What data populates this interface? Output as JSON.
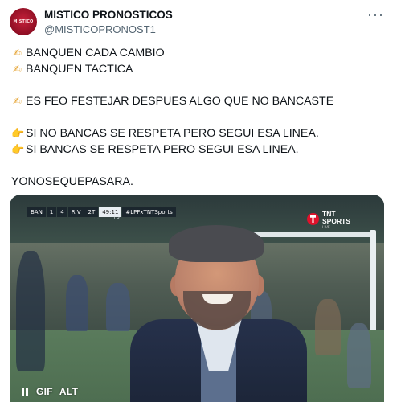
{
  "post": {
    "author_name": "MISTICO PRONOSTICOS",
    "author_handle": "@MISTICOPRONOST1",
    "avatar_text": "MISTICO",
    "more_label": "···",
    "lines": [
      {
        "emoji": "✍",
        "emoji_kind": "writing-hand-icon",
        "text": "BANQUEN CADA CAMBIO"
      },
      {
        "emoji": "✍",
        "emoji_kind": "writing-hand-icon",
        "text": "BANQUEN TACTICA"
      },
      {
        "gap": true
      },
      {
        "emoji": "✍",
        "emoji_kind": "writing-hand-icon",
        "text": "ES FEO FESTEJAR DESPUES ALGO QUE NO BANCASTE"
      },
      {
        "gap": true
      },
      {
        "emoji": "👉",
        "emoji_kind": "pointing-hand-icon",
        "text": "SI NO BANCAS SE RESPETA PERO SEGUI ESA LINEA."
      },
      {
        "emoji": "👉",
        "emoji_kind": "pointing-hand-icon",
        "text": "SI BANCAS SE RESPETA PERO SEGUI ESA LINEA."
      },
      {
        "gap": true
      },
      {
        "emoji": "",
        "text": "YONOSEQUEPASARA."
      }
    ]
  },
  "media": {
    "scoreboard": {
      "home": "BAN",
      "home_score": "1",
      "away_score": "4",
      "away": "RIV",
      "period": "2T",
      "clock": "49:11",
      "added": "+5",
      "hashtag": "#LPFxTNTSports"
    },
    "broadcaster": {
      "line1": "TNT",
      "line2": "SPORTS",
      "live": "LIVE"
    },
    "controls": {
      "pause_label": "pause",
      "gif_label": "GIF",
      "alt_label": "ALT"
    },
    "colors": {
      "tnt_red": "#e0112b",
      "coat": "#26314b"
    }
  }
}
